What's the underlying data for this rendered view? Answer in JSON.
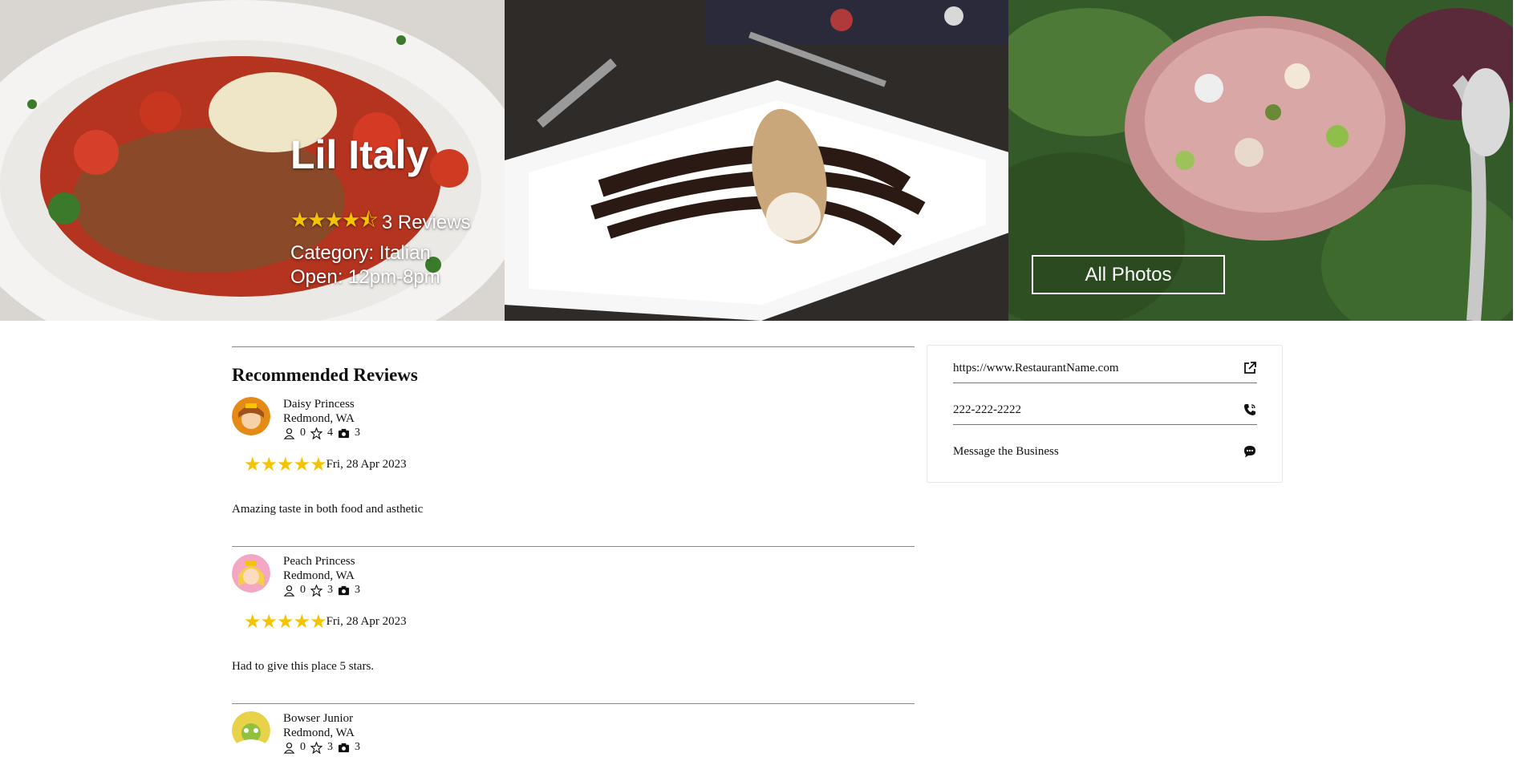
{
  "hero": {
    "title": "Lil Italy",
    "stars": "★★★★⯪",
    "reviews_count": "3 Reviews",
    "category": "Category: Italian",
    "hours": "Open: 12pm-8pm",
    "all_photos_label": "All Photos"
  },
  "reviews_section": {
    "title": "Recommended Reviews",
    "items": [
      {
        "name": "Daisy Princess",
        "location": "Redmond, WA",
        "friends": "0",
        "stars_count": "4",
        "photos": "3",
        "stars": "★★★★★",
        "date": "Fri, 28 Apr 2023",
        "text": "Amazing taste in both food and asthetic",
        "rating": 5
      },
      {
        "name": "Peach Princess",
        "location": "Redmond, WA",
        "friends": "0",
        "stars_count": "3",
        "photos": "3",
        "stars": "★★★★★",
        "date": "Fri, 28 Apr 2023",
        "text": "Had to give this place 5 stars.",
        "rating": 5
      },
      {
        "name": "Bowser Junior",
        "location": "Redmond, WA",
        "friends": "0",
        "stars_count": "3",
        "photos": "3"
      }
    ]
  },
  "sidebar": {
    "website": "https://www.RestaurantName.com",
    "phone": "222-222-2222",
    "message": "Message the Business"
  },
  "colors": {
    "star": "#f5c400",
    "divider": "#888888"
  },
  "icons": {
    "friends": "person-icon",
    "stars": "star-outline-icon",
    "photos": "camera-icon",
    "website": "external-link-icon",
    "phone": "phone-icon",
    "message": "chat-bubble-icon"
  }
}
